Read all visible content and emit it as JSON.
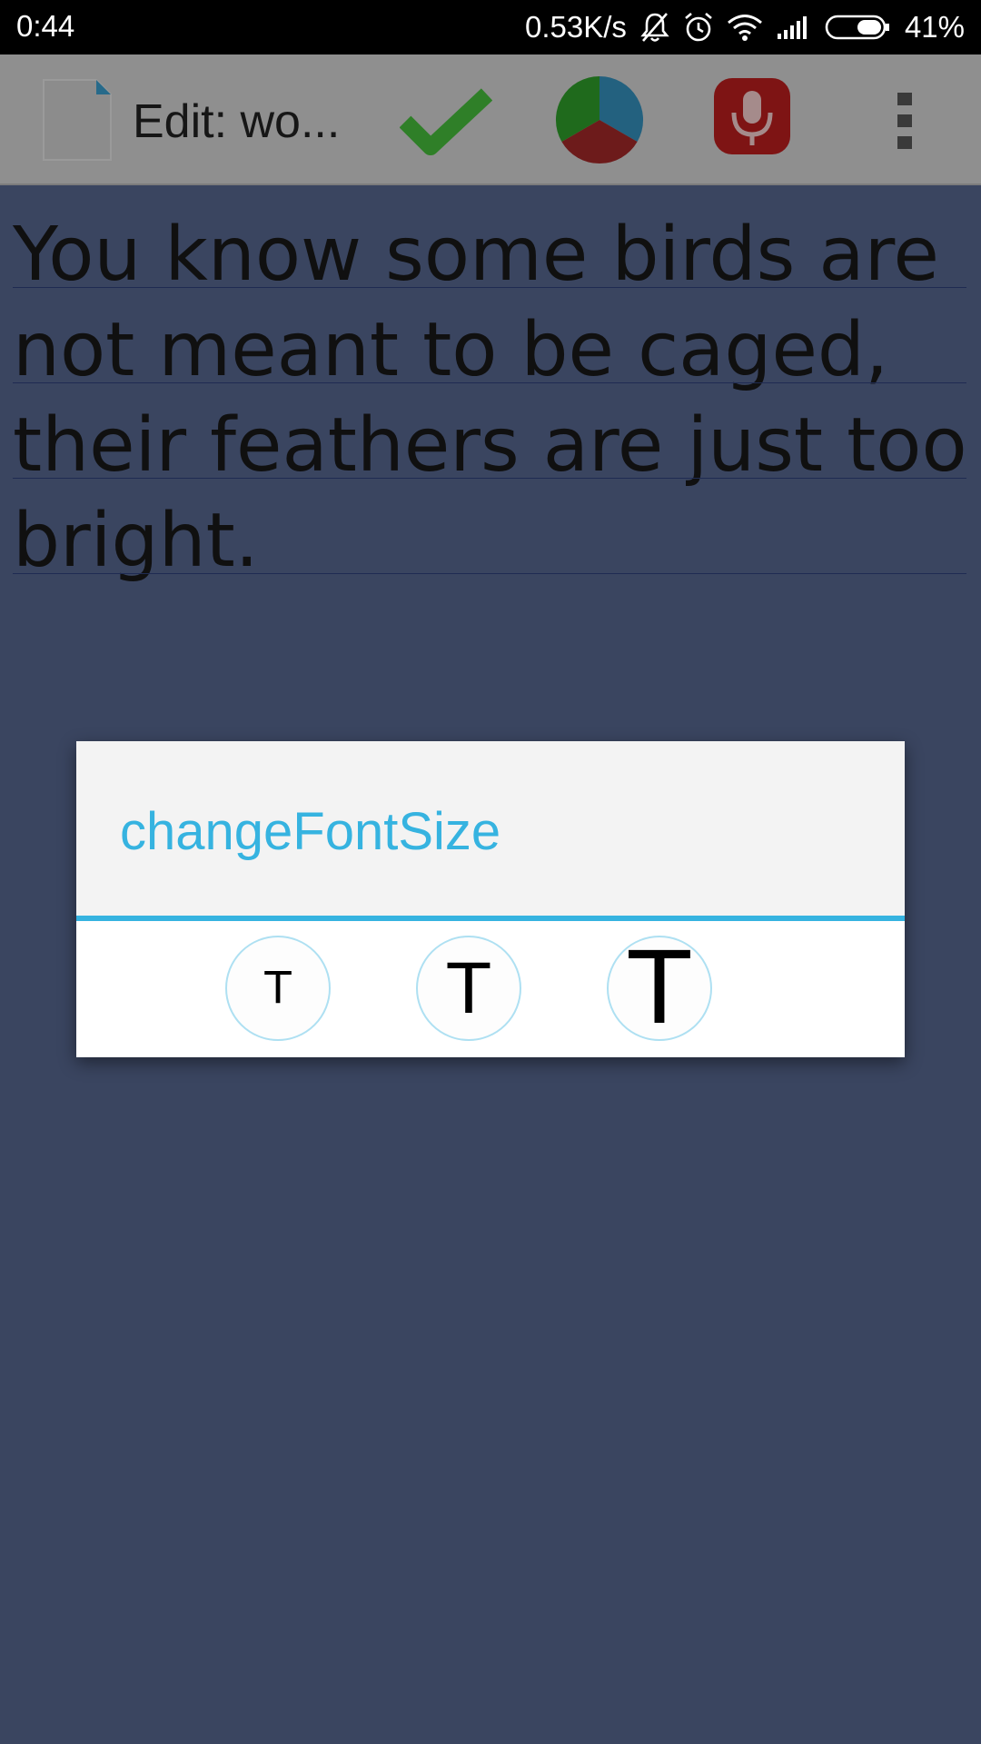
{
  "status_bar": {
    "time": "0:44",
    "network_speed": "0.53K/s",
    "battery": "41%"
  },
  "action_bar": {
    "title": "Edit: wo...",
    "icons": [
      "document-icon",
      "checkmark-icon",
      "pie-chart-icon",
      "microphone-icon",
      "more-vert-icon"
    ]
  },
  "editor": {
    "text": "You know some birds are not meant to be caged, their feathers are just too bright."
  },
  "dialog": {
    "title": "changeFontSize",
    "options": [
      "T",
      "T",
      "T"
    ]
  },
  "colors": {
    "background": "#3a4560",
    "accent": "#36b3e0",
    "action_bar": "#8f8f8f"
  }
}
